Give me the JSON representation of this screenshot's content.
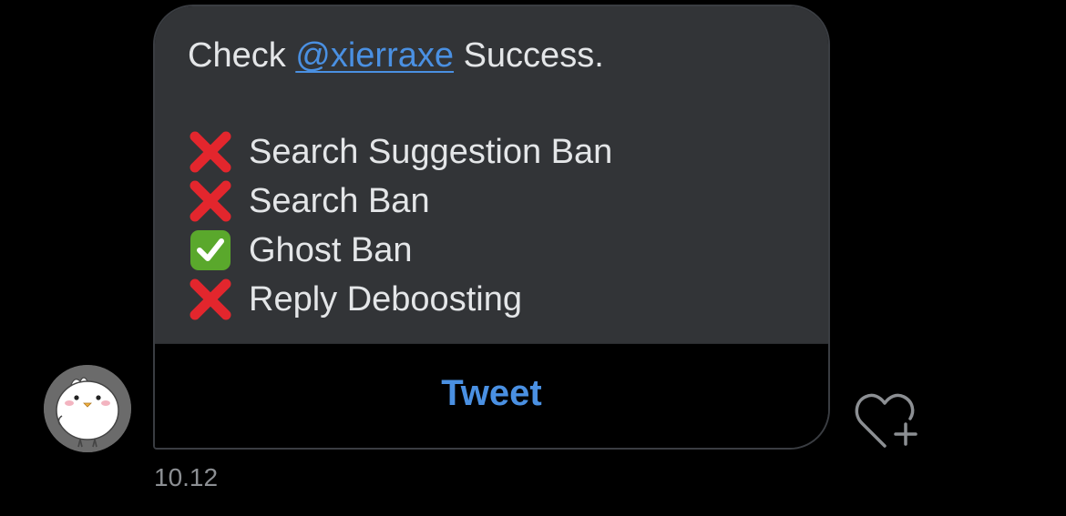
{
  "message": {
    "intro_prefix": "Check",
    "mention": "@xierraxe",
    "intro_suffix": "Success.",
    "checks": [
      {
        "label": "Search Suggestion Ban",
        "status": "cross",
        "icon": "cross-mark-icon"
      },
      {
        "label": "Search Ban",
        "status": "cross",
        "icon": "cross-mark-icon"
      },
      {
        "label": "Ghost Ban",
        "status": "check",
        "icon": "check-mark-icon"
      },
      {
        "label": "Reply Deboosting",
        "status": "cross",
        "icon": "cross-mark-icon"
      }
    ],
    "button_label": "Tweet",
    "timestamp": "10.12"
  },
  "icons": {
    "avatar": "chick-avatar-icon",
    "like": "heart-plus-icon"
  },
  "colors": {
    "background": "#000000",
    "bubble": "#323437",
    "text": "#e4e6e8",
    "link": "#4a90e2",
    "cross": "#e3262d",
    "check": "#5aa82c",
    "muted": "#8c8f93"
  }
}
